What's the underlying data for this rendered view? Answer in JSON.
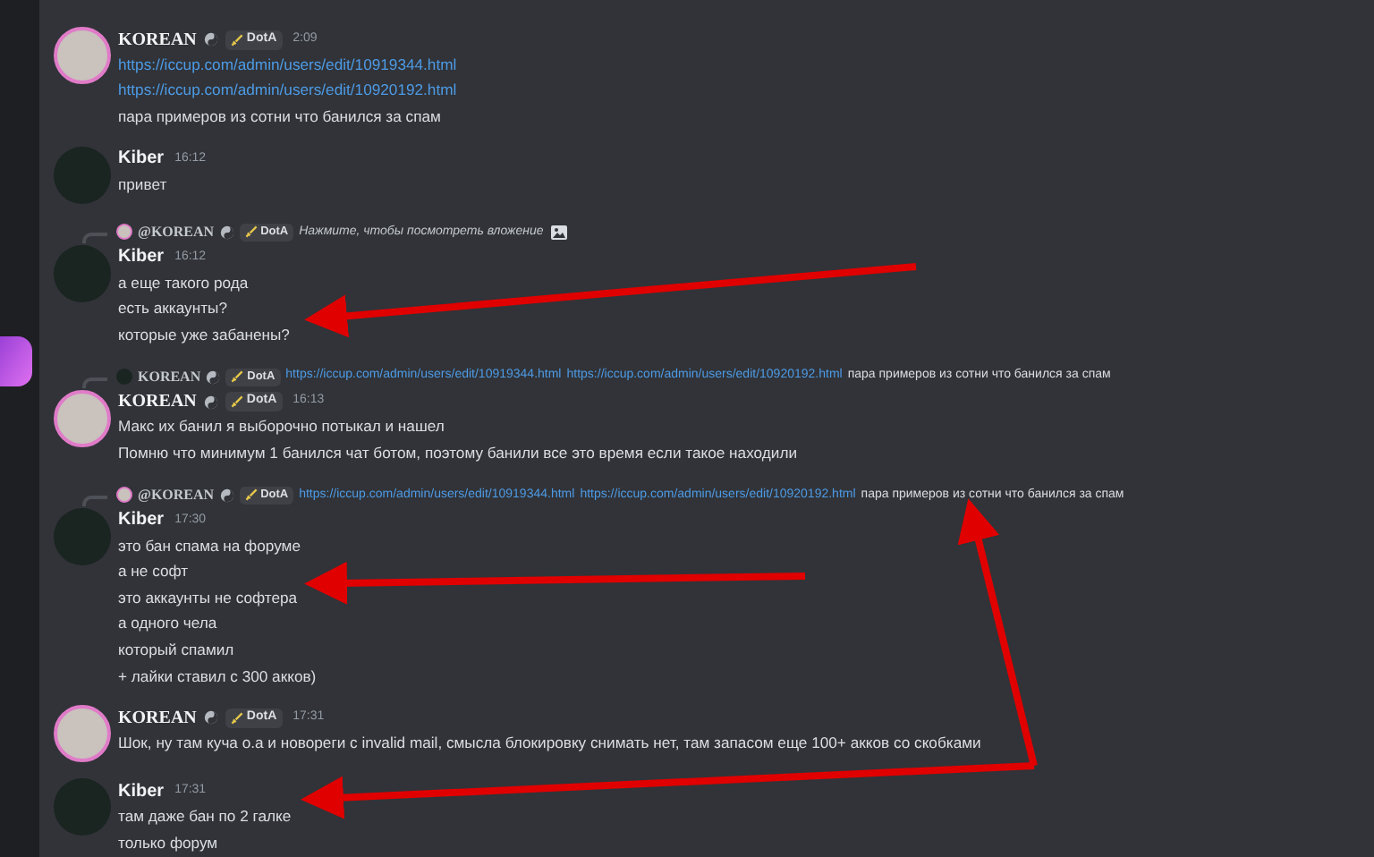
{
  "messages": [
    {
      "author": "KOREAN",
      "tag": "DotA",
      "timestamp": "2:09",
      "kind": "decorated",
      "lines": [
        [
          {
            "kind": "link",
            "text": "https://iccup.com/admin/users/edit/10919344.html"
          }
        ],
        [
          {
            "kind": "link",
            "text": "https://iccup.com/admin/users/edit/10920192.html"
          }
        ],
        [
          {
            "kind": "text",
            "text": "пара примеров из сотни что банился за спам"
          }
        ]
      ]
    },
    {
      "author": "Kiber",
      "timestamp": "16:12",
      "kind": "plain",
      "lines": [
        [
          {
            "kind": "text",
            "text": "привет"
          }
        ]
      ]
    },
    {
      "author": "Kiber",
      "timestamp": "16:12",
      "kind": "plain",
      "reply": {
        "author": "@KOREAN",
        "tag": "DotA",
        "segments": [
          {
            "kind": "attachment",
            "text": "Нажмите, чтобы посмотреть вложение"
          }
        ]
      },
      "lines": [
        [
          {
            "kind": "text",
            "text": "а еще такого рода"
          }
        ],
        [
          {
            "kind": "text",
            "text": "есть аккаунты?"
          }
        ],
        [
          {
            "kind": "text",
            "text": "которые уже забанены?"
          }
        ]
      ]
    },
    {
      "author": "KOREAN",
      "tag": "DotA",
      "timestamp": "16:13",
      "kind": "decorated",
      "reply": {
        "author": "KOREAN",
        "tag": "DotA",
        "segments": [
          {
            "kind": "link",
            "text": "https://iccup.com/admin/users/edit/10919344.html"
          },
          {
            "kind": "link",
            "text": "https://iccup.com/admin/users/edit/10920192.html"
          },
          {
            "kind": "text",
            "text": "пара примеров из сотни что банился за спам"
          }
        ]
      },
      "lines": [
        [
          {
            "kind": "text",
            "text": "Макс их банил я выборочно потыкал и нашел"
          }
        ],
        [
          {
            "kind": "text",
            "text": "Помню что минимум 1 банился чат ботом, поэтому банили все это время если такое находили"
          }
        ]
      ]
    },
    {
      "author": "Kiber",
      "timestamp": "17:30",
      "kind": "plain",
      "reply": {
        "author": "@KOREAN",
        "tag": "DotA",
        "segments": [
          {
            "kind": "link",
            "text": "https://iccup.com/admin/users/edit/10919344.html"
          },
          {
            "kind": "link",
            "text": "https://iccup.com/admin/users/edit/10920192.html"
          },
          {
            "kind": "text",
            "text": "пара примеров из сотни что банился за спам"
          }
        ]
      },
      "lines": [
        [
          {
            "kind": "text",
            "text": "это бан спама на форуме"
          }
        ],
        [
          {
            "kind": "text",
            "text": "а не софт"
          }
        ],
        [
          {
            "kind": "text",
            "text": "это аккаунты не софтера"
          }
        ],
        [
          {
            "kind": "text",
            "text": "а одного чела"
          }
        ],
        [
          {
            "kind": "text",
            "text": "который спамил"
          }
        ],
        [
          {
            "kind": "text",
            "text": "+ лайки ставил с 300 акков)"
          }
        ]
      ]
    },
    {
      "author": "KOREAN",
      "tag": "DotA",
      "timestamp": "17:31",
      "kind": "decorated",
      "lines": [
        [
          {
            "kind": "text",
            "text": "Шок, ну там куча о.а и новореги с invalid mail, смысла блокировку снимать нет, там запасом еще 100+ акков со скобками"
          }
        ]
      ]
    },
    {
      "author": "Kiber",
      "timestamp": "17:31",
      "kind": "plain",
      "lines": [
        [
          {
            "kind": "text",
            "text": "там даже бан по 2 галке"
          }
        ],
        [
          {
            "kind": "text",
            "text": "только форум"
          }
        ]
      ]
    }
  ]
}
